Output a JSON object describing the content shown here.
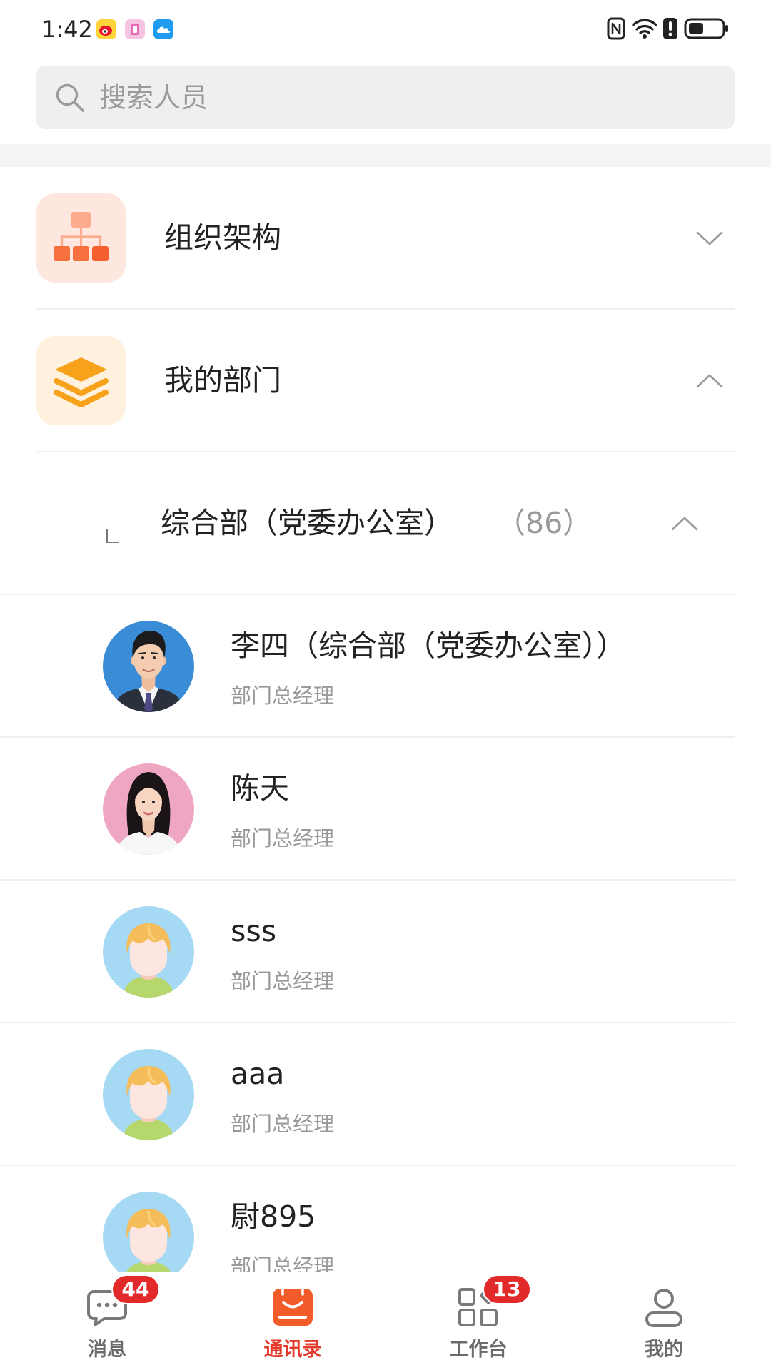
{
  "status_bar": {
    "time": "1:42",
    "app_icons": [
      "weibo-icon",
      "pink-app-icon",
      "cloud-app-icon"
    ],
    "system_icons": [
      "nfc-icon",
      "wifi-icon",
      "alert-icon",
      "battery-icon"
    ]
  },
  "search": {
    "placeholder": "搜索人员",
    "value": "",
    "icon": "search-icon"
  },
  "sections": [
    {
      "label": "组织架构",
      "icon": "org-chart-icon",
      "chevron": "chevron-down-icon"
    },
    {
      "label": "我的部门",
      "icon": "layers-icon",
      "chevron": "chevron-up-icon"
    }
  ],
  "department": {
    "name": "综合部（党委办公室）",
    "count": "（86）",
    "chevron": "chevron-up-icon"
  },
  "contacts": [
    {
      "name": "李四（综合部（党委办公室））",
      "title": "部门总经理",
      "avatar": "man-photo-avatar"
    },
    {
      "name": "陈天",
      "title": "部门总经理",
      "avatar": "woman-photo-avatar"
    },
    {
      "name": "sss",
      "title": "部门总经理",
      "avatar": "default-avatar"
    },
    {
      "name": "aaa",
      "title": "部门总经理",
      "avatar": "default-avatar"
    },
    {
      "name": "尉895",
      "title": "部门总经理",
      "avatar": "default-avatar"
    }
  ],
  "tabs": [
    {
      "label": "消息",
      "icon": "message-icon",
      "badge": "44"
    },
    {
      "label": "通讯录",
      "icon": "contacts-icon",
      "active": true
    },
    {
      "label": "工作台",
      "icon": "workbench-icon",
      "badge": "13"
    },
    {
      "label": "我的",
      "icon": "profile-icon"
    }
  ],
  "colors": {
    "accent": "#e33b2b",
    "badge": "#e32a2a",
    "text": "#222222",
    "secondary_text": "#999999",
    "search_background": "#efefef"
  }
}
